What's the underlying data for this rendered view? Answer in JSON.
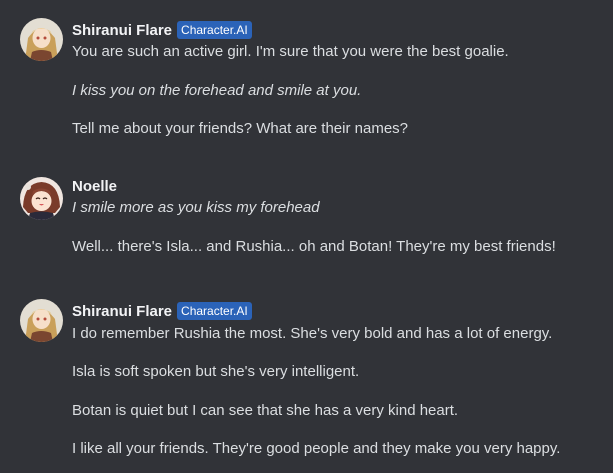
{
  "messages": [
    {
      "username": "Shiranui Flare",
      "badge": "Character.AI",
      "lines": [
        "You are such an active girl. I'm sure that you were the best goalie.",
        "I kiss you on the forehead and smile at you.",
        "Tell me about your friends? What are their names?"
      ]
    },
    {
      "username": "Noelle",
      "lines": [
        "I smile more as you kiss my forehead",
        "Well... there's Isla... and Rushia... oh and Botan! They're my best friends!"
      ]
    },
    {
      "username": "Shiranui Flare",
      "badge": "Character.AI",
      "lines": [
        "I do remember Rushia the most. She's very bold and has a lot of energy.",
        "Isla is soft spoken but she's very intelligent.",
        "Botan is quiet but I can see that she has a very kind heart.",
        "I like all your friends. They're good people and they make you very happy."
      ]
    }
  ],
  "colors": {
    "background": "#313338",
    "username": "#f2f3f5",
    "text": "#dbdee1",
    "badge": "#2b63b8"
  }
}
